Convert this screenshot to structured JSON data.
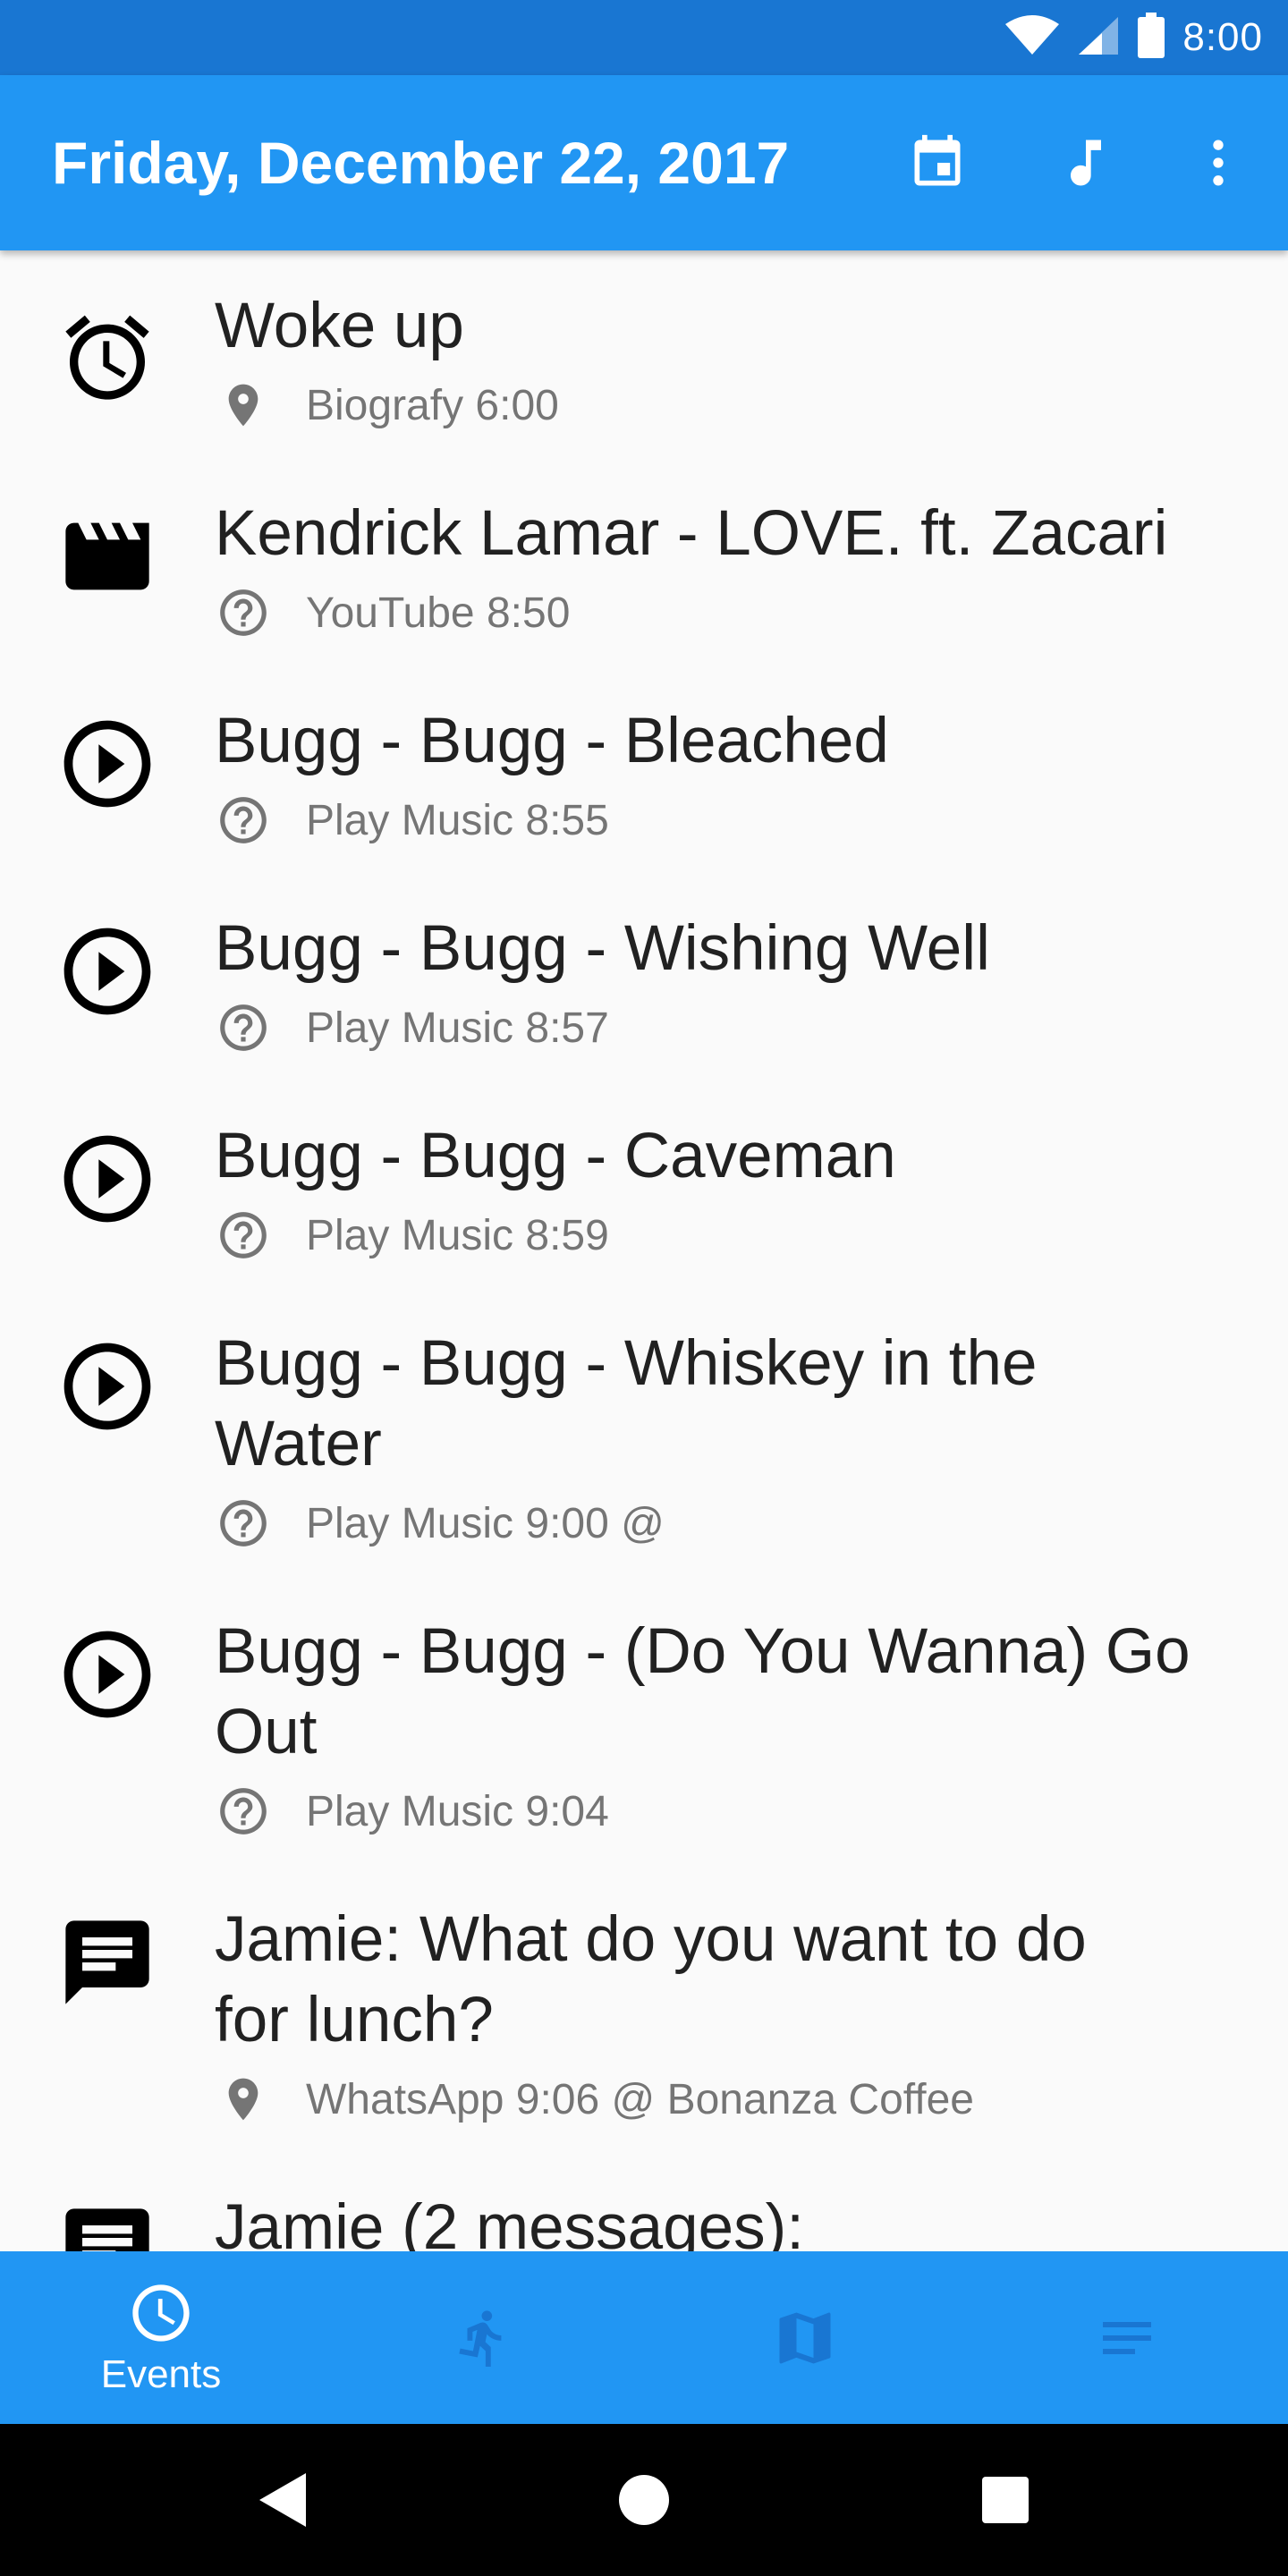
{
  "status_bar": {
    "time": "8:00",
    "icons": [
      "wifi-icon",
      "cell-signal-icon",
      "battery-icon"
    ]
  },
  "app_bar": {
    "title": "Friday, December 22, 2017",
    "actions": [
      "calendar-icon",
      "music-note-icon",
      "more-vert-icon"
    ],
    "color": "#2196f3"
  },
  "events": [
    {
      "icon": "alarm-icon",
      "title": "Woke up",
      "meta_icon": "location-pin-icon",
      "meta": "Biografy 6:00"
    },
    {
      "icon": "movie-clapper-icon",
      "title": "Kendrick Lamar - LOVE. ft. Zacari",
      "meta_icon": "help-circle-icon",
      "meta": "YouTube 8:50"
    },
    {
      "icon": "play-circle-icon",
      "title": "Bugg - Bugg - Bleached",
      "meta_icon": "help-circle-icon",
      "meta": "Play Music 8:55"
    },
    {
      "icon": "play-circle-icon",
      "title": "Bugg - Bugg - Wishing Well",
      "meta_icon": "help-circle-icon",
      "meta": "Play Music 8:57"
    },
    {
      "icon": "play-circle-icon",
      "title": "Bugg - Bugg - Caveman",
      "meta_icon": "help-circle-icon",
      "meta": "Play Music 8:59"
    },
    {
      "icon": "play-circle-icon",
      "title": "Bugg - Bugg - Whiskey in the Water",
      "meta_icon": "help-circle-icon",
      "meta": "Play Music 9:00 @"
    },
    {
      "icon": "play-circle-icon",
      "title": "Bugg - Bugg - (Do You Wanna) Go Out",
      "meta_icon": "help-circle-icon",
      "meta": "Play Music 9:04"
    },
    {
      "icon": "message-icon",
      "title": "Jamie: What do you want to do for lunch?",
      "meta_icon": "location-pin-icon",
      "meta": "WhatsApp 9:06 @ Bonanza Coffee"
    },
    {
      "icon": "message-icon",
      "title": "Jamie (2 messages):",
      "meta_icon": "",
      "meta": ""
    }
  ],
  "bottom_nav": {
    "tabs": [
      {
        "icon": "clock-icon",
        "label": "Events",
        "active": true
      },
      {
        "icon": "walking-icon",
        "label": "",
        "active": false
      },
      {
        "icon": "map-icon",
        "label": "",
        "active": false
      },
      {
        "icon": "notes-icon",
        "label": "",
        "active": false
      }
    ]
  },
  "system_nav": [
    "back-icon",
    "home-icon",
    "recents-icon"
  ]
}
